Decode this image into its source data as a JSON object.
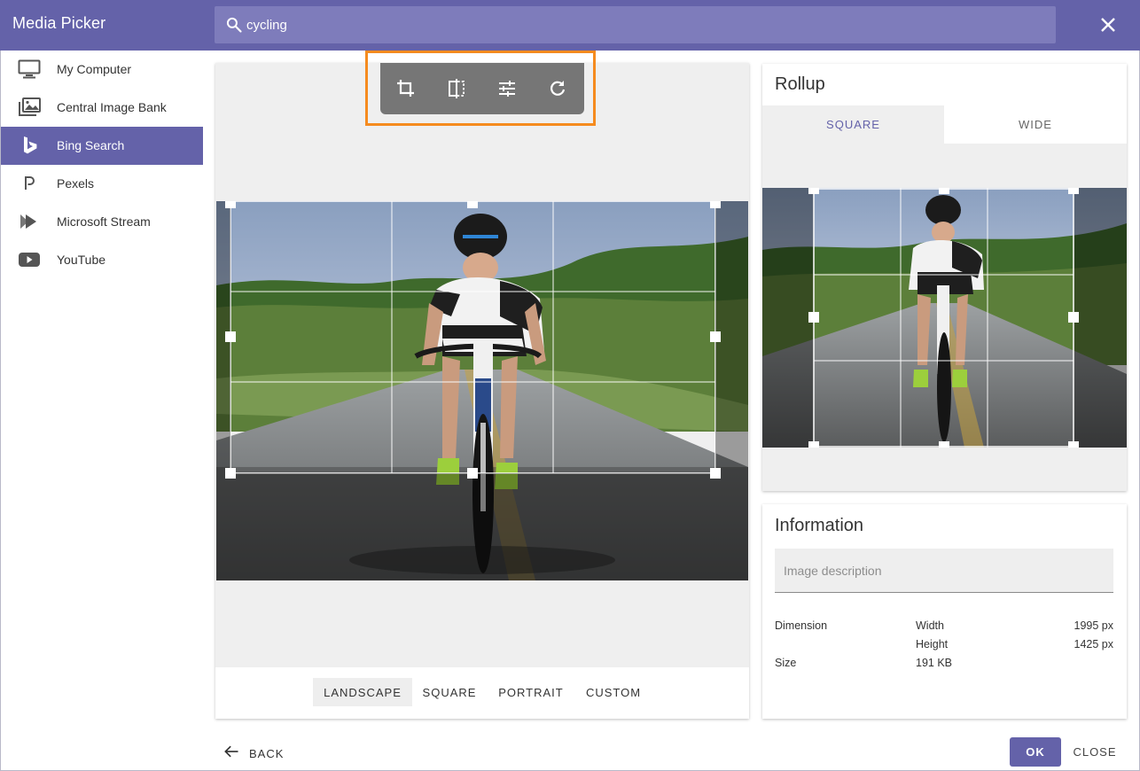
{
  "header": {
    "title": "Media Picker",
    "search": {
      "value": "cycling",
      "placeholder": ""
    }
  },
  "sidebar": {
    "items": [
      {
        "label": "My Computer",
        "icon": "monitor-icon",
        "active": false
      },
      {
        "label": "Central Image Bank",
        "icon": "image-library-icon",
        "active": false
      },
      {
        "label": "Bing Search",
        "icon": "bing-icon",
        "active": true
      },
      {
        "label": "Pexels",
        "icon": "pexels-icon",
        "active": false
      },
      {
        "label": "Microsoft Stream",
        "icon": "stream-icon",
        "active": false
      },
      {
        "label": "YouTube",
        "icon": "youtube-icon",
        "active": false
      }
    ]
  },
  "editor": {
    "tools": [
      {
        "name": "crop-icon"
      },
      {
        "name": "flip-icon"
      },
      {
        "name": "adjust-icon"
      },
      {
        "name": "rotate-icon"
      }
    ],
    "ratios": [
      "LANDSCAPE",
      "SQUARE",
      "PORTRAIT",
      "CUSTOM"
    ],
    "selected_ratio": "LANDSCAPE"
  },
  "rollup": {
    "title": "Rollup",
    "tabs": [
      "SQUARE",
      "WIDE"
    ],
    "selected_tab": "SQUARE"
  },
  "information": {
    "title": "Information",
    "description_placeholder": "Image description",
    "dimension_label": "Dimension",
    "width_label": "Width",
    "width_value": "1995 px",
    "height_label": "Height",
    "height_value": "1425 px",
    "size_label": "Size",
    "size_value": "191 KB"
  },
  "footer": {
    "back_label": "BACK",
    "ok_label": "OK",
    "close_label": "CLOSE"
  },
  "colors": {
    "accent": "#6462a9",
    "highlight": "#f58b1f"
  }
}
